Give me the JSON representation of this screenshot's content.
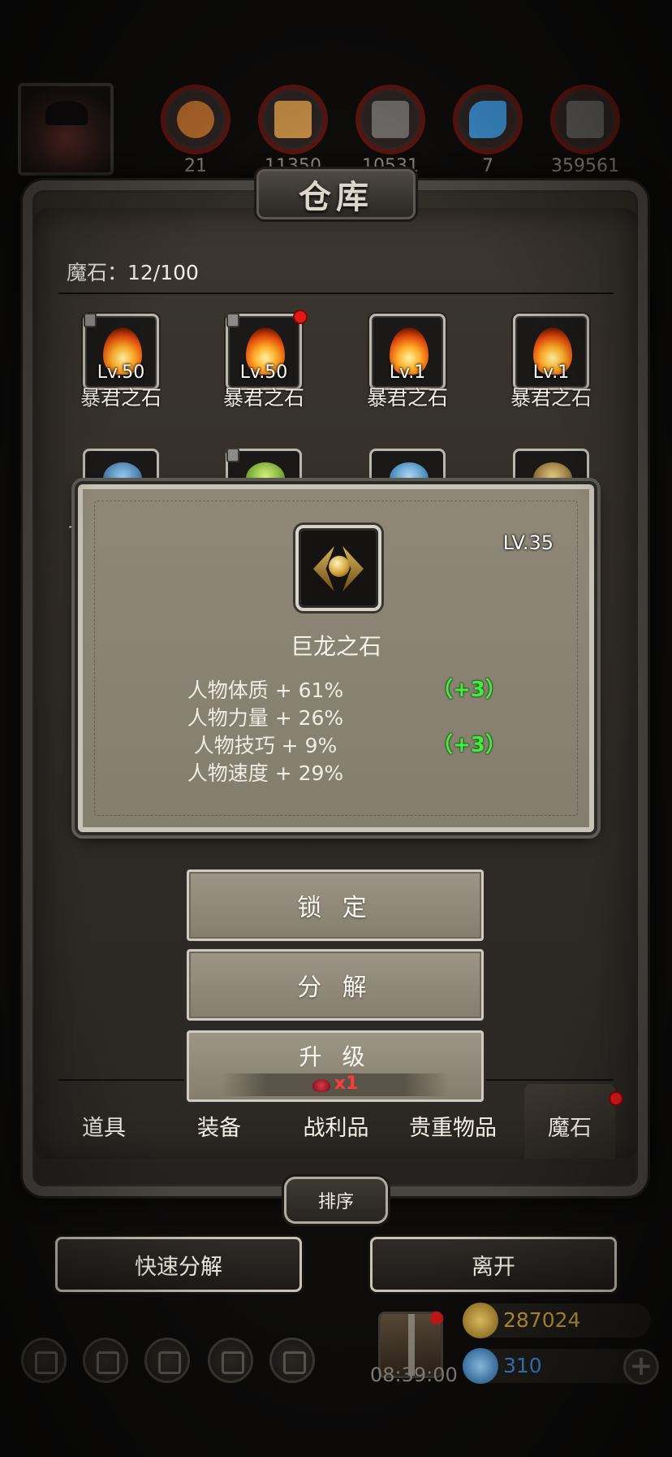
{
  "top_bar": {
    "resources": [
      {
        "name": "leather-resource-icon",
        "value": "21",
        "color": "#b46a2c"
      },
      {
        "name": "wood-resource-icon",
        "value": "11350",
        "color": "#c08a44"
      },
      {
        "name": "iron-resource-icon",
        "value": "10531",
        "color": "#6e6b68"
      },
      {
        "name": "crystal-resource-icon",
        "value": "7",
        "color": "#3a8ac8"
      },
      {
        "name": "stone-resource-icon",
        "value": "359561",
        "color": "#5c5a58"
      }
    ]
  },
  "warehouse": {
    "title": "仓库",
    "count_label": "魔石：12/100",
    "items": [
      {
        "level": "Lv.50",
        "name": "暴君之石",
        "locked": true,
        "new": false
      },
      {
        "level": "Lv.50",
        "name": "暴君之石",
        "locked": true,
        "new": true
      },
      {
        "level": "Lv.1",
        "name": "暴君之石",
        "locked": false,
        "new": false
      },
      {
        "level": "Lv.1",
        "name": "暴君之石",
        "locked": false,
        "new": false
      }
    ],
    "row2_partial_label": "古"
  },
  "detail": {
    "level": "LV.35",
    "name": "巨龙之石",
    "stats": [
      {
        "text": "人物体质 + 61%",
        "bonus": "（+3）"
      },
      {
        "text": "人物力量 + 26%",
        "bonus": ""
      },
      {
        "text": "人物技巧 + 9%",
        "bonus": "（+3）"
      },
      {
        "text": "人物速度 + 29%",
        "bonus": ""
      }
    ],
    "lock_label": "锁 定",
    "decompose_label": "分 解",
    "upgrade_label": "升 级",
    "upgrade_cost": "x1"
  },
  "tabs": [
    {
      "label": "道具"
    },
    {
      "label": "装备"
    },
    {
      "label": "战利品"
    },
    {
      "label": "贵重物品"
    },
    {
      "label": "魔石"
    }
  ],
  "sort_label": "排序",
  "quick_decompose_label": "快速分解",
  "leave_label": "离开",
  "hud": {
    "timer": "08:39:00",
    "gold": "287024",
    "gems": "310",
    "gold_color": "#c59a3a",
    "gem_color": "#3a86d6"
  }
}
